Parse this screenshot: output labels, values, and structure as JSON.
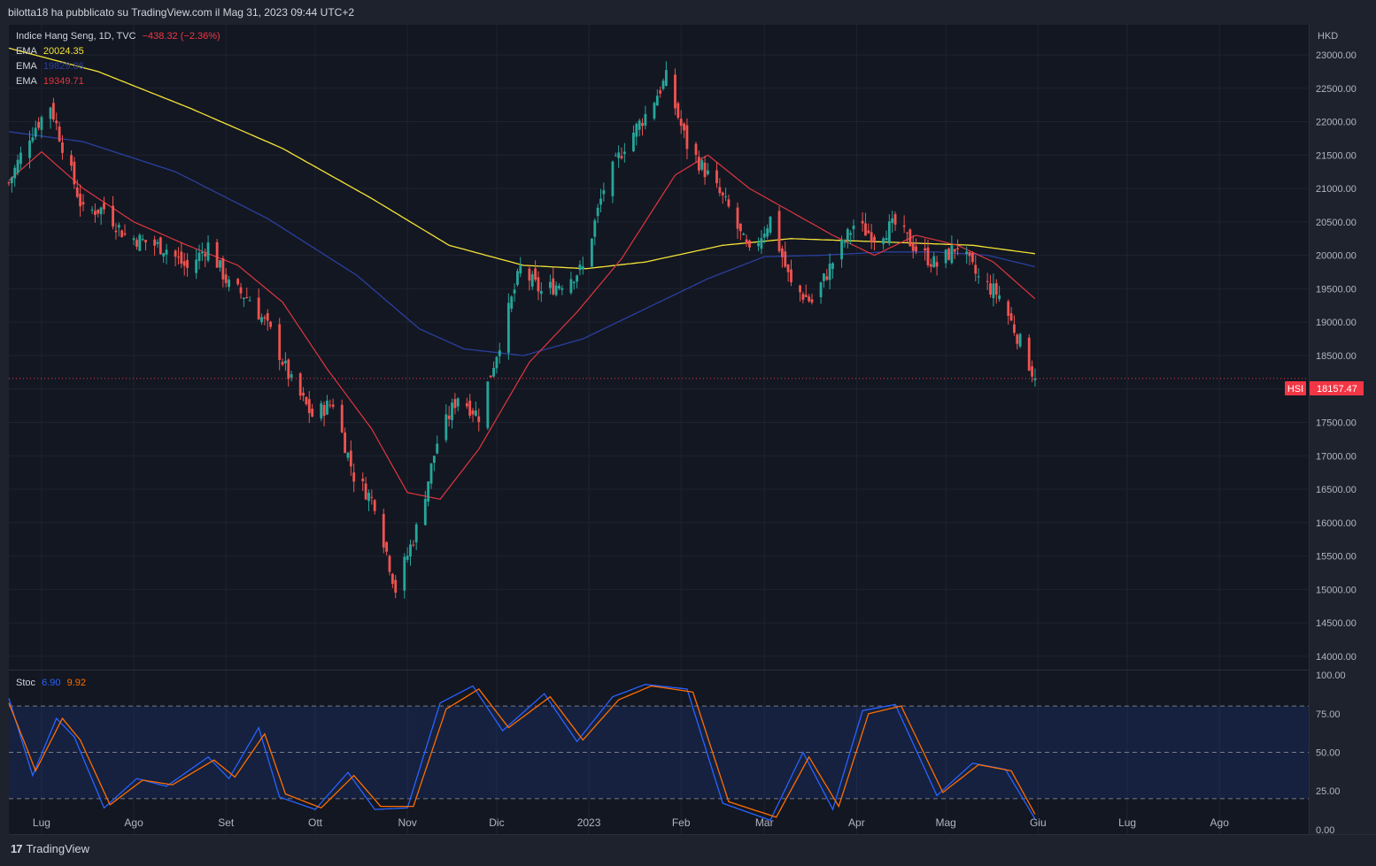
{
  "header": {
    "shared_by": "bilotta18 ha pubblicato su TradingView.com il Mag 31, 2023 09:44 UTC+2"
  },
  "legend": {
    "instrument": "Indice Hang Seng, 1D, TVC",
    "change": "−438.32 (−2.36%)",
    "ema_rows": [
      {
        "label": "EMA",
        "value": "20024.35",
        "color": "#f5e338"
      },
      {
        "label": "EMA",
        "value": "19829.86",
        "color": "#2a3f9e"
      },
      {
        "label": "EMA",
        "value": "19349.71",
        "color": "#e0363f"
      }
    ],
    "stoch_label": "Stoc",
    "stoch_k": "6.90",
    "stoch_d": "9.92"
  },
  "price_axis": {
    "currency": "HKD",
    "ticks": [
      "23000.00",
      "22500.00",
      "22000.00",
      "21500.00",
      "21000.00",
      "20500.00",
      "20000.00",
      "19500.00",
      "19000.00",
      "18500.00",
      "18000.00",
      "17500.00",
      "17000.00",
      "16500.00",
      "16000.00",
      "15500.00",
      "15000.00",
      "14500.00",
      "14000.00"
    ],
    "last_symbol": "HSI",
    "last_price": "18157.47"
  },
  "stoch_axis": {
    "ticks": [
      "100.00",
      "75.00",
      "50.00",
      "25.00",
      "0.00"
    ]
  },
  "time_axis": {
    "labels": [
      "Lug",
      "Ago",
      "Set",
      "Ott",
      "Nov",
      "Dic",
      "2023",
      "Feb",
      "Mar",
      "Apr",
      "Mag",
      "Giu",
      "Lug",
      "Ago"
    ]
  },
  "footer": {
    "brand": "TradingView"
  },
  "colors": {
    "up": "#26a69a",
    "down": "#ef5350",
    "ema_fast": "#e0363f",
    "ema_mid": "#2a3f9e",
    "ema_slow": "#f5e338",
    "stoch_k": "#2962ff",
    "stoch_d": "#ff6d00",
    "band": "#2962ff"
  },
  "chart_data": {
    "type": "candlestick",
    "title": "Indice Hang Seng, 1D, TVC",
    "y_unit": "HKD",
    "ylim": [
      13800,
      23450
    ],
    "stoch_ylim": [
      -3,
      103
    ],
    "stoch_bands": [
      20,
      80,
      50
    ],
    "last_price": 18157.47,
    "x_range": [
      "2022-06-20",
      "2023-08-31"
    ],
    "ohlc_anchors": [
      [
        "2022-06-20",
        21080
      ],
      [
        "2022-06-27",
        21800
      ],
      [
        "2022-07-04",
        22250
      ],
      [
        "2022-07-08",
        21650
      ],
      [
        "2022-07-15",
        20650
      ],
      [
        "2022-07-22",
        20700
      ],
      [
        "2022-07-29",
        20300
      ],
      [
        "2022-08-05",
        20200
      ],
      [
        "2022-08-12",
        20100
      ],
      [
        "2022-08-19",
        19800
      ],
      [
        "2022-08-26",
        20150
      ],
      [
        "2022-09-02",
        19550
      ],
      [
        "2022-09-09",
        19350
      ],
      [
        "2022-09-16",
        18850
      ],
      [
        "2022-09-23",
        18100
      ],
      [
        "2022-09-30",
        17600
      ],
      [
        "2022-10-07",
        17800
      ],
      [
        "2022-10-14",
        16700
      ],
      [
        "2022-10-21",
        16300
      ],
      [
        "2022-10-28",
        15000
      ],
      [
        "2022-11-04",
        15900
      ],
      [
        "2022-11-11",
        17200
      ],
      [
        "2022-11-18",
        17900
      ],
      [
        "2022-11-25",
        17600
      ],
      [
        "2022-12-02",
        18700
      ],
      [
        "2022-12-09",
        19800
      ],
      [
        "2022-12-16",
        19450
      ],
      [
        "2022-12-23",
        19600
      ],
      [
        "2022-12-30",
        19800
      ],
      [
        "2023-01-06",
        21000
      ],
      [
        "2023-01-13",
        21650
      ],
      [
        "2023-01-20",
        22100
      ],
      [
        "2023-01-27",
        22650
      ],
      [
        "2023-02-03",
        21650
      ],
      [
        "2023-02-10",
        21200
      ],
      [
        "2023-02-17",
        20700
      ],
      [
        "2023-02-24",
        20000
      ],
      [
        "2023-03-03",
        20550
      ],
      [
        "2023-03-10",
        19550
      ],
      [
        "2023-03-17",
        19300
      ],
      [
        "2023-03-24",
        19900
      ],
      [
        "2023-03-31",
        20450
      ],
      [
        "2023-04-07",
        20300
      ],
      [
        "2023-04-14",
        20450
      ],
      [
        "2023-04-21",
        20100
      ],
      [
        "2023-04-28",
        19850
      ],
      [
        "2023-05-05",
        20150
      ],
      [
        "2023-05-12",
        19650
      ],
      [
        "2023-05-19",
        19400
      ],
      [
        "2023-05-26",
        18700
      ],
      [
        "2023-05-31",
        18157.47
      ]
    ],
    "ema_fast_anchors": [
      [
        "2022-06-20",
        21120
      ],
      [
        "2022-07-01",
        21550
      ],
      [
        "2022-07-15",
        21000
      ],
      [
        "2022-08-01",
        20500
      ],
      [
        "2022-08-19",
        20150
      ],
      [
        "2022-09-05",
        19850
      ],
      [
        "2022-09-20",
        19300
      ],
      [
        "2022-10-05",
        18300
      ],
      [
        "2022-10-20",
        17400
      ],
      [
        "2022-11-01",
        16450
      ],
      [
        "2022-11-12",
        16350
      ],
      [
        "2022-11-25",
        17100
      ],
      [
        "2022-12-12",
        18400
      ],
      [
        "2022-12-28",
        19150
      ],
      [
        "2023-01-12",
        19950
      ],
      [
        "2023-01-30",
        21200
      ],
      [
        "2023-02-10",
        21500
      ],
      [
        "2023-02-24",
        21000
      ],
      [
        "2023-03-10",
        20650
      ],
      [
        "2023-03-24",
        20300
      ],
      [
        "2023-04-07",
        20000
      ],
      [
        "2023-04-21",
        20300
      ],
      [
        "2023-05-05",
        20150
      ],
      [
        "2023-05-17",
        19900
      ],
      [
        "2023-05-31",
        19349.71
      ]
    ],
    "ema_mid_anchors": [
      [
        "2022-06-20",
        21850
      ],
      [
        "2022-07-15",
        21700
      ],
      [
        "2022-08-15",
        21250
      ],
      [
        "2022-09-15",
        20550
      ],
      [
        "2022-10-15",
        19700
      ],
      [
        "2022-11-05",
        18900
      ],
      [
        "2022-11-20",
        18600
      ],
      [
        "2022-12-10",
        18500
      ],
      [
        "2022-12-30",
        18750
      ],
      [
        "2023-01-20",
        19200
      ],
      [
        "2023-02-10",
        19650
      ],
      [
        "2023-03-01",
        19980
      ],
      [
        "2023-03-20",
        20000
      ],
      [
        "2023-04-10",
        20050
      ],
      [
        "2023-04-28",
        20050
      ],
      [
        "2023-05-15",
        20000
      ],
      [
        "2023-05-31",
        19829.86
      ]
    ],
    "ema_slow_anchors": [
      [
        "2022-06-20",
        23100
      ],
      [
        "2022-07-20",
        22750
      ],
      [
        "2022-08-20",
        22200
      ],
      [
        "2022-09-20",
        21600
      ],
      [
        "2022-10-20",
        20850
      ],
      [
        "2022-11-15",
        20150
      ],
      [
        "2022-12-10",
        19850
      ],
      [
        "2022-12-31",
        19800
      ],
      [
        "2023-01-20",
        19900
      ],
      [
        "2023-02-15",
        20150
      ],
      [
        "2023-03-10",
        20250
      ],
      [
        "2023-04-10",
        20200
      ],
      [
        "2023-05-10",
        20150
      ],
      [
        "2023-05-31",
        20024.35
      ]
    ],
    "stoch_k_anchors": [
      [
        "2022-06-20",
        85
      ],
      [
        "2022-06-28",
        35
      ],
      [
        "2022-07-06",
        72
      ],
      [
        "2022-07-12",
        60
      ],
      [
        "2022-07-22",
        14
      ],
      [
        "2022-08-02",
        33
      ],
      [
        "2022-08-12",
        28
      ],
      [
        "2022-08-26",
        47
      ],
      [
        "2022-09-02",
        33
      ],
      [
        "2022-09-12",
        66
      ],
      [
        "2022-09-19",
        21
      ],
      [
        "2022-10-01",
        13
      ],
      [
        "2022-10-12",
        37
      ],
      [
        "2022-10-21",
        13
      ],
      [
        "2022-11-01",
        14
      ],
      [
        "2022-11-12",
        82
      ],
      [
        "2022-11-23",
        93
      ],
      [
        "2022-12-03",
        64
      ],
      [
        "2022-12-17",
        88
      ],
      [
        "2022-12-28",
        57
      ],
      [
        "2023-01-09",
        86
      ],
      [
        "2023-01-20",
        94
      ],
      [
        "2023-02-03",
        91
      ],
      [
        "2023-02-15",
        17
      ],
      [
        "2023-03-03",
        6
      ],
      [
        "2023-03-14",
        50
      ],
      [
        "2023-03-24",
        13
      ],
      [
        "2023-04-03",
        77
      ],
      [
        "2023-04-14",
        81
      ],
      [
        "2023-04-28",
        22
      ],
      [
        "2023-05-10",
        43
      ],
      [
        "2023-05-21",
        39
      ],
      [
        "2023-05-31",
        6.9
      ]
    ],
    "stoch_d_anchors": [
      [
        "2022-06-20",
        82
      ],
      [
        "2022-06-29",
        38
      ],
      [
        "2022-07-08",
        72
      ],
      [
        "2022-07-14",
        58
      ],
      [
        "2022-07-24",
        16
      ],
      [
        "2022-08-04",
        32
      ],
      [
        "2022-08-14",
        29
      ],
      [
        "2022-08-28",
        45
      ],
      [
        "2022-09-04",
        34
      ],
      [
        "2022-09-14",
        62
      ],
      [
        "2022-09-21",
        23
      ],
      [
        "2022-10-03",
        14
      ],
      [
        "2022-10-14",
        35
      ],
      [
        "2022-10-23",
        15
      ],
      [
        "2022-11-03",
        15
      ],
      [
        "2022-11-14",
        78
      ],
      [
        "2022-11-25",
        91
      ],
      [
        "2022-12-05",
        66
      ],
      [
        "2022-12-19",
        86
      ],
      [
        "2022-12-30",
        58
      ],
      [
        "2023-01-11",
        84
      ],
      [
        "2023-01-22",
        93
      ],
      [
        "2023-02-05",
        89
      ],
      [
        "2023-02-17",
        18
      ],
      [
        "2023-03-05",
        8
      ],
      [
        "2023-03-16",
        47
      ],
      [
        "2023-03-26",
        15
      ],
      [
        "2023-04-05",
        75
      ],
      [
        "2023-04-16",
        80
      ],
      [
        "2023-04-30",
        24
      ],
      [
        "2023-05-12",
        42
      ],
      [
        "2023-05-23",
        38
      ],
      [
        "2023-05-31",
        9.92
      ]
    ]
  }
}
